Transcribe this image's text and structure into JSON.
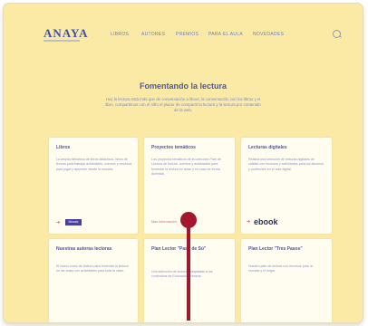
{
  "header": {
    "logo": "ANAYA",
    "nav": [
      "LIBROS",
      "AUTORES",
      "PREMIOS",
      "PARA EL AULA",
      "NOVEDADES"
    ]
  },
  "hero": {
    "title": "Fomentando la lectura",
    "subtitle": "Hoy la lectura está más que de conversación a libros, la conversación con los libros y el libro, compartimos con el niño el placer de compartir la lectura y la lectura por contenido de la web."
  },
  "cards": [
    {
      "title": "Libros",
      "text": "La amplia biblioteca de libros didácticos, libros de lectura para trabajar actividades, cuentos y recursos para jugar y aprender desde la escuela.",
      "badge": "Mosaic"
    },
    {
      "title": "Proyectos temáticos",
      "text": "Los proyectos temáticos de la colección Plan de Lectura de lectura, cuentos y actividades para fomentar la lectura en clase y en casa de forma divertida.",
      "link": "Más información"
    },
    {
      "title": "Lecturas digitales",
      "text": "Realiza una selección de lecturas digitales de calidad con recursos y actividades para los alumnos y profesores en el aula digital.",
      "badge": "ebook"
    },
    {
      "title": "Nuestras autoras lectoras",
      "text": "El nuevo curso de lectura para fomentar la lectura en las aulas con actividades para toda la clase."
    },
    {
      "title": "Plan Lector \"Paso de Sú\"",
      "text": "Una selección de lecturas adaptadas a los contenidos de Educación Primaria."
    },
    {
      "title": "Plan Lector \"Tres Pasos\"",
      "text": "Nuestro plan de lectura con recursos para la escuela y el hogar."
    }
  ],
  "colors": {
    "page_background": "#fbeaa6",
    "card_background": "#fffcf0",
    "accent": "#4c57a3",
    "pointer": "#a3162e"
  }
}
